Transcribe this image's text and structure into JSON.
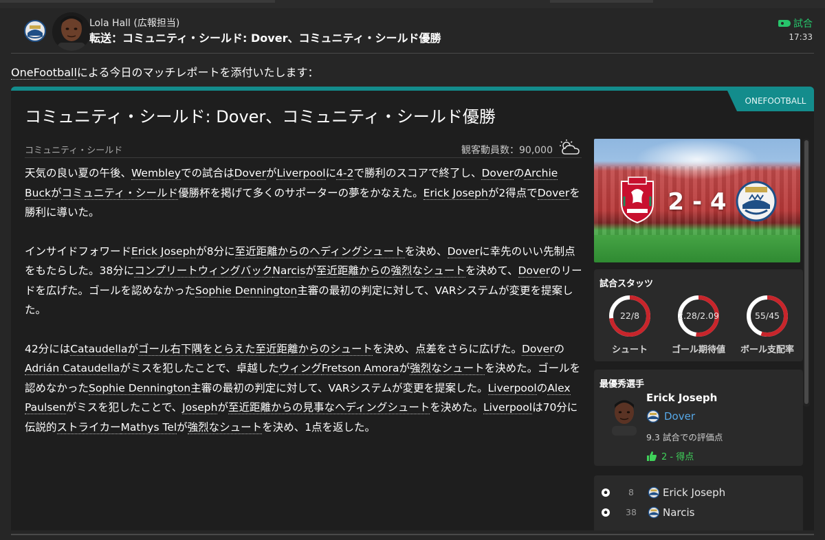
{
  "message": {
    "sender": "Lola Hall (広報担当)",
    "subject": "転送：コミュニティ・シールド: Dover、コミュニティ・シールド優勝",
    "tag": "試合",
    "time": "17:33",
    "intro_link": "OneFootball",
    "intro_rest": "による今日のマッチレポートを添付いたします："
  },
  "report": {
    "source_tab": "ONEFOOTBALL",
    "title": "コミュニティ・シールド: Dover、コミュニティ・シールド優勝",
    "competition": "コミュニティ・シールド",
    "attendance": "観客動員数：90,000",
    "weather_icon": "partly-cloudy-icon",
    "accent_color": "#138c8c"
  },
  "score": {
    "home": "2",
    "away": "4",
    "separator": "-",
    "home_team": "Liverpool",
    "away_team": "Dover"
  },
  "stats": {
    "title": "試合スタッツ",
    "items": [
      {
        "value": "22/8",
        "label": "シュート",
        "home_share": 0.73
      },
      {
        "value": "2.28/2.09",
        "label": "ゴール期待値",
        "home_share": 0.52
      },
      {
        "value": "55/45",
        "label": "ボール支配率",
        "home_share": 0.55
      }
    ],
    "ring_home_color": "#c8252b",
    "ring_away_color": "#ffffff"
  },
  "potm": {
    "title": "最優秀選手",
    "name": "Erick Joseph",
    "club": "Dover",
    "rating": "9.3 試合での評価点",
    "goals": "2 - 得点"
  },
  "goals": [
    {
      "minute": "8",
      "name": "Erick Joseph"
    },
    {
      "minute": "38",
      "name": "Narcis"
    }
  ],
  "article": {
    "p1": [
      "天気の良い夏の午後、",
      "Wembley",
      "での試合は",
      "Dover",
      "が",
      "Liverpool",
      "に",
      "4-2",
      "で勝利のスコアで終了し、",
      "Dover",
      "の",
      "Archie Buck",
      "が",
      "コミュニティ・シールド",
      "優勝杯を掲げて多くのサポーターの夢をかなえた。",
      "Erick Joseph",
      "が2得点で",
      "Dover",
      "を勝利に導いた。"
    ],
    "p2": [
      "インサイドフォワード",
      "Erick Joseph",
      "が8分に",
      "至近距離からのヘディングシュート",
      "を決め、",
      "Dover",
      "に幸先のいい先制点をもたらした。38分に",
      "コンプリートウィングバック",
      "Narcis",
      "が",
      "至近距離からの強烈なシュート",
      "を決めて、",
      "Dover",
      "のリードを広げた。ゴールを認めなかった",
      "Sophie Dennington",
      "主審の最初の判定に対して、VARシステムが変更を提案した。"
    ],
    "p3": [
      "42分には",
      "Cataudella",
      "が",
      "ゴール右下隅をとらえた至近距離からのシュート",
      "を決め、点差をさらに広げた。",
      "Dover",
      "の",
      "Adrián Cataudella",
      "がミスを犯したことで、卓越した",
      "ウィング",
      "Fretson Amora",
      "が",
      "強烈なシュート",
      "を決めた。ゴールを認めなかった",
      "Sophie Dennington",
      "主審の最初の判定に対して、VARシステムが変更を提案した。",
      "Liverpool",
      "の",
      "Alex Paulsen",
      "がミスを犯したことで、",
      "Joseph",
      "が",
      "至近距離からの見事なヘディングシュート",
      "を決めた。",
      "Liverpool",
      "は70分に伝説的",
      "ストライカー",
      "Mathys Tel",
      "が",
      "強烈なシュート",
      "を決め、1点を返した。"
    ]
  }
}
